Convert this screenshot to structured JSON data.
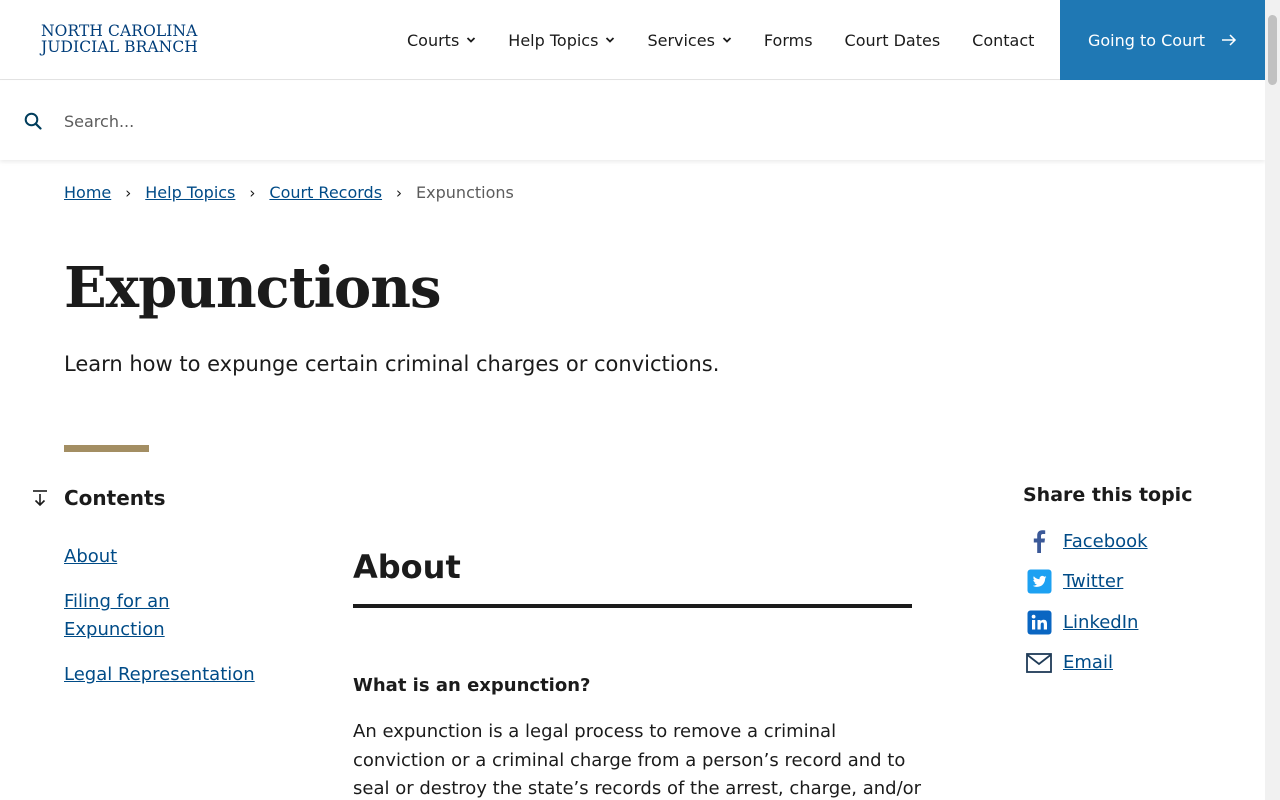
{
  "header": {
    "logo_line1": "NORTH CAROLINA",
    "logo_line2": "JUDICIAL BRANCH",
    "nav": [
      {
        "label": "Courts",
        "has_dropdown": true
      },
      {
        "label": "Help Topics",
        "has_dropdown": true
      },
      {
        "label": "Services",
        "has_dropdown": true
      },
      {
        "label": "Forms",
        "has_dropdown": false
      },
      {
        "label": "Court Dates",
        "has_dropdown": false
      },
      {
        "label": "Contact",
        "has_dropdown": false
      }
    ],
    "cta_label": "Going to Court",
    "cta_icon": "arrow-right-icon"
  },
  "search": {
    "placeholder": "Search...",
    "value": "",
    "icon": "search-icon"
  },
  "breadcrumb": {
    "items": [
      "Home",
      "Help Topics",
      "Court Records"
    ],
    "current": "Expunctions"
  },
  "page": {
    "title": "Expunctions",
    "subtitle": "Learn how to expunge certain criminal charges or convictions."
  },
  "contents": {
    "title": "Contents",
    "items": [
      "About",
      "Filing for an Expunction",
      "Legal Representation"
    ]
  },
  "main": {
    "section_title": "About",
    "question": "What is an expunction?",
    "paragraph": "An expunction is a legal process to remove a criminal conviction or a criminal charge from a person’s record and to seal or destroy the state’s records of the arrest, charge, and/or"
  },
  "share": {
    "title": "Share this topic",
    "items": [
      {
        "label": "Facebook",
        "icon": "facebook-icon"
      },
      {
        "label": "Twitter",
        "icon": "twitter-icon"
      },
      {
        "label": "LinkedIn",
        "icon": "linkedin-icon"
      },
      {
        "label": "Email",
        "icon": "email-icon"
      }
    ]
  },
  "colors": {
    "brand_blue": "#004b87",
    "cta_blue": "#1f78b4",
    "accent_gold": "#a38e63"
  }
}
